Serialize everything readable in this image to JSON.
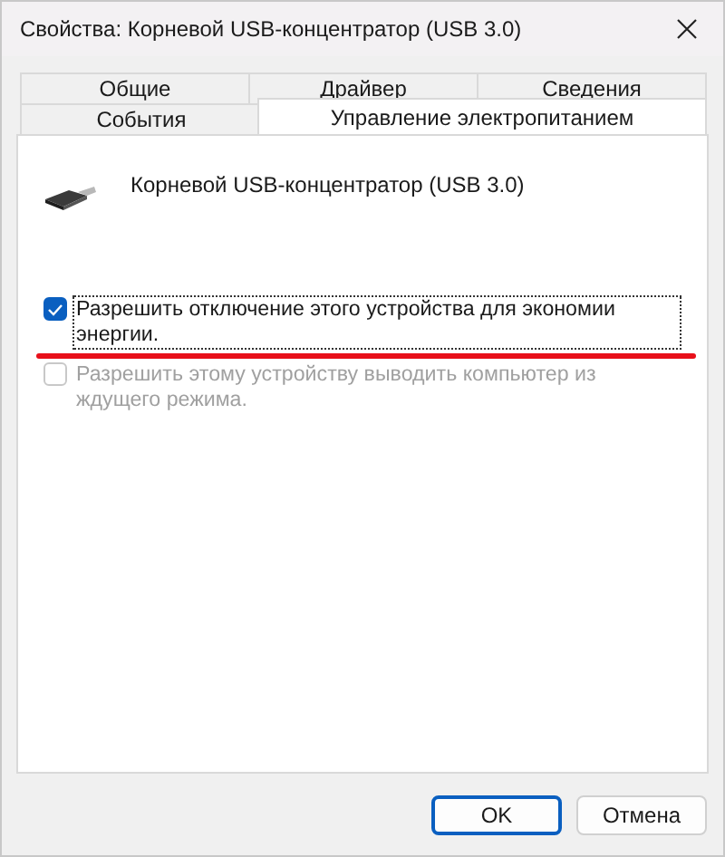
{
  "window": {
    "title": "Свойства: Корневой USB-концентратор (USB 3.0)"
  },
  "tab_rows": [
    [
      {
        "label": "Общие",
        "selected": false
      },
      {
        "label": "Драйвер",
        "selected": false
      },
      {
        "label": "Сведения",
        "selected": false
      }
    ],
    [
      {
        "label": "События",
        "selected": false
      },
      {
        "label": "Управление электропитанием",
        "selected": true
      }
    ]
  ],
  "device": {
    "name": "Корневой USB-концентратор (USB 3.0)"
  },
  "options": [
    {
      "label": "Разрешить отключение этого устройства для экономии энергии.",
      "checked": true,
      "disabled": false,
      "focused": true
    },
    {
      "label": "Разрешить этому устройству выводить компьютер из ждущего режима.",
      "checked": false,
      "disabled": true,
      "focused": false
    }
  ],
  "annotation": {
    "kind": "underline"
  },
  "buttons": [
    {
      "label": "OK",
      "default": true
    },
    {
      "label": "Отмена",
      "default": false
    }
  ]
}
